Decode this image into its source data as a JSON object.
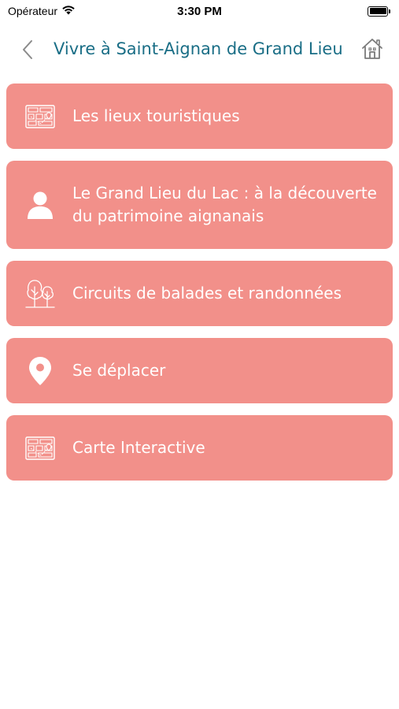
{
  "status_bar": {
    "carrier": "Opérateur",
    "time": "3:30 PM"
  },
  "nav": {
    "title": "Vivre à Saint-Aignan de Grand Lieu",
    "back_icon": "chevron-left-icon",
    "home_icon": "home-icon"
  },
  "menu": {
    "items": [
      {
        "label": "Les lieux touristiques",
        "icon": "map-icon"
      },
      {
        "label": "Le Grand Lieu du Lac : à la découverte du patrimoine aignanais",
        "icon": "person-icon"
      },
      {
        "label": "Circuits de balades et randonnées",
        "icon": "trees-icon"
      },
      {
        "label": "Se déplacer",
        "icon": "location-pin-icon"
      },
      {
        "label": "Carte Interactive",
        "icon": "map-icon"
      }
    ]
  },
  "colors": {
    "accent_title": "#1a6e86",
    "tile_background": "#f2908a",
    "tile_text": "#ffffff"
  }
}
